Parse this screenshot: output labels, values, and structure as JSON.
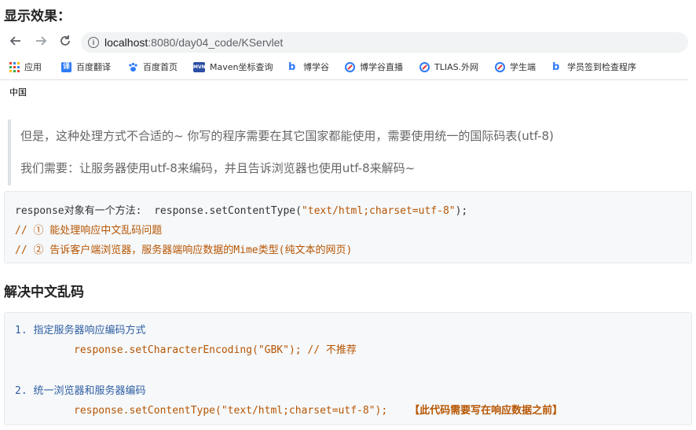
{
  "heading_top": "显示效果：",
  "browser": {
    "back_icon": "arrow-left-icon",
    "forward_icon": "arrow-right-icon",
    "reload_icon": "reload-icon",
    "url_host": "localhost",
    "url_rest": ":8080/day04_code/KServlet",
    "bookmarks": [
      {
        "label": "应用",
        "icon": "apps-grid-icon",
        "color": "#4285f4"
      },
      {
        "label": "百度翻译",
        "icon": "baidu-translate-icon",
        "color": "#2f7bf5"
      },
      {
        "label": "百度首页",
        "icon": "baidu-paw-icon",
        "color": "#2f7bf5"
      },
      {
        "label": "Maven坐标查询",
        "icon": "maven-icon",
        "color": "#2b4fa3"
      },
      {
        "label": "博学谷",
        "icon": "boxuegu-icon",
        "color": "#2f7bf5"
      },
      {
        "label": "博学谷直播",
        "icon": "boxuegu-live-icon",
        "color": "#2f7bf5"
      },
      {
        "label": "TLIAS.外网",
        "icon": "tlias-icon",
        "color": "#2f7bf5"
      },
      {
        "label": "学生端",
        "icon": "student-icon",
        "color": "#2f7bf5"
      },
      {
        "label": "学员签到检查程序",
        "icon": "checkin-icon",
        "color": "#2f7bf5"
      }
    ],
    "page_content": "中国"
  },
  "quote": {
    "line1": "但是，这种处理方式不合适的~ 你写的程序需要在其它国家都能使用，需要使用统一的国际码表(utf-8)",
    "line2": "我们需要：让服务器使用utf-8来编码，并且告诉浏览器也使用utf-8来解码~"
  },
  "code1": {
    "l1_prefix": "response对象有一个方法:  response.setContentType(",
    "l1_string": "\"text/html;charset=utf-8\"",
    "l1_suffix": ");",
    "l2": "// ① 能处理响应中文乱码问题",
    "l3": "// ② 告诉客户端浏览器，服务器端响应数据的Mime类型(纯文本的网页)"
  },
  "heading_solve": "解决中文乱码",
  "code2": {
    "l1": "1. 指定服务器响应编码方式",
    "l2_code": "response.setCharacterEncoding(",
    "l2_string": "\"GBK\"",
    "l2_suffix": "); // 不推荐",
    "l3": "2. 统一浏览器和服务器编码",
    "l4_code": "response.setContentType(",
    "l4_string": "\"text/html;charset=utf-8\"",
    "l4_suffix": ");",
    "l4_note": "【此代码需要写在响应数据之前】"
  }
}
